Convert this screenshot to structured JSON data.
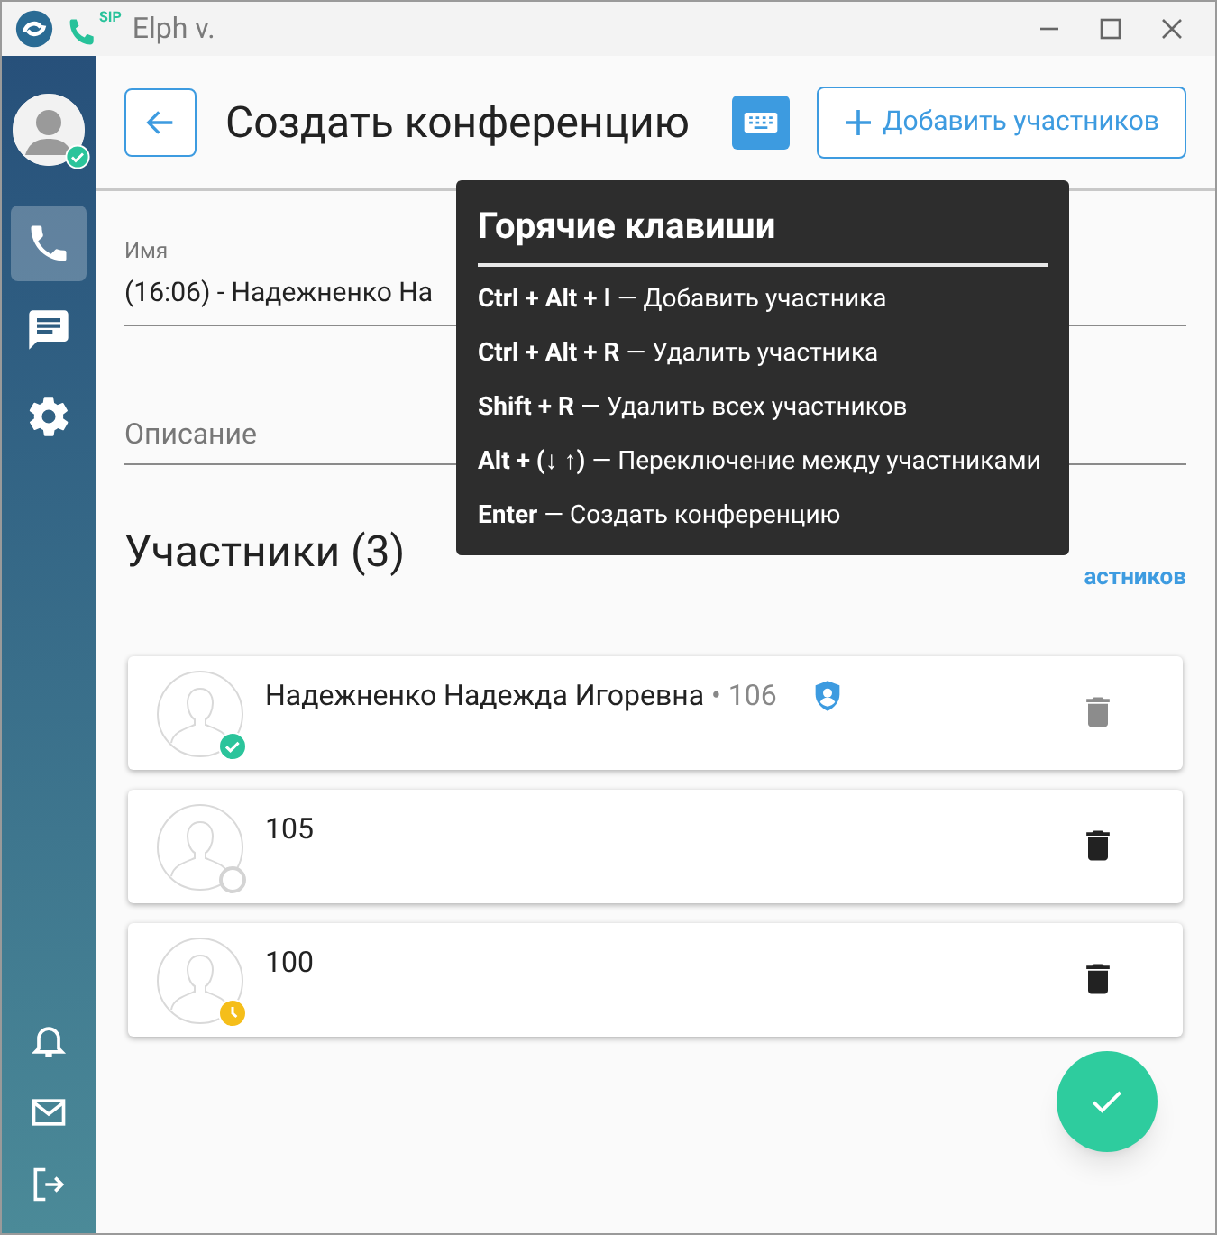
{
  "window": {
    "title": "Elph v.",
    "app_badge": "SIP"
  },
  "sidebar": {
    "items": [
      {
        "kind": "phone",
        "selected": true
      },
      {
        "kind": "chat",
        "selected": false
      },
      {
        "kind": "settings",
        "selected": false
      }
    ],
    "bottom_items": [
      {
        "kind": "bell"
      },
      {
        "kind": "mail"
      },
      {
        "kind": "logout"
      }
    ],
    "user_online": true
  },
  "header": {
    "title": "Создать конференцию",
    "add_button": "Добавить участников"
  },
  "form": {
    "name_label": "Имя",
    "name_value": "(16:06) - Надежненко На",
    "description_placeholder": "Описание"
  },
  "participants_title": "Участники (3)",
  "delete_all_link": "астников",
  "participants": [
    {
      "name": "Надежненко Надежда Игоревна",
      "extension": "• 106",
      "kind": "online",
      "admin": true,
      "delete_disabled": true
    },
    {
      "name": "105",
      "kind": "offline",
      "admin": false,
      "delete_disabled": false
    },
    {
      "name": "100",
      "kind": "away",
      "admin": false,
      "delete_disabled": false
    }
  ],
  "hotkeys_tooltip": {
    "title": "Горячие клавиши",
    "items": [
      {
        "keys": "Ctrl + Alt + I",
        "action": "— Добавить участника"
      },
      {
        "keys": "Ctrl + Alt + R",
        "action": "— Удалить участника"
      },
      {
        "keys": "Shift + R",
        "action": "— Удалить всех участников"
      },
      {
        "keys": "Alt + (↓ ↑)",
        "action": "— Переключение между участниками"
      },
      {
        "keys": "Enter",
        "action": "— Создать конференцию"
      }
    ]
  }
}
